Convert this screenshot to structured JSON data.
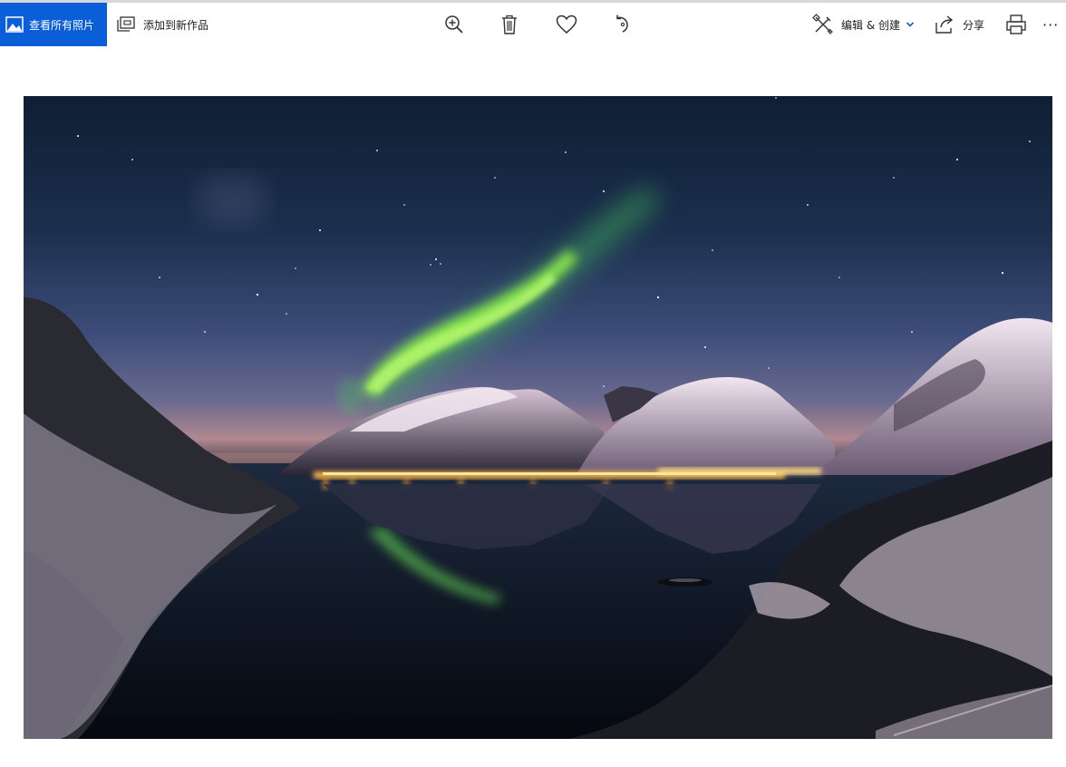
{
  "toolbar": {
    "view_all_label": "查看所有照片",
    "add_to_label": "添加到新作品",
    "edit_create_label": "编辑 & 创建",
    "share_label": "分享",
    "more_label": "···"
  },
  "icons": {
    "photos_app": "photos-app-icon",
    "add_to": "add-to-creation-icon",
    "zoom": "zoom-in-icon",
    "delete": "trash-icon",
    "favorite": "heart-icon",
    "rotate": "rotate-icon",
    "edit": "edit-create-icon",
    "chevron": "chevron-down-icon",
    "share": "share-icon",
    "print": "print-icon"
  },
  "colors": {
    "accent": "#0a5ed7",
    "aurora": "#7ee84a",
    "sky_top": "#0f1e33",
    "sky_horizon": "#4a5680"
  }
}
